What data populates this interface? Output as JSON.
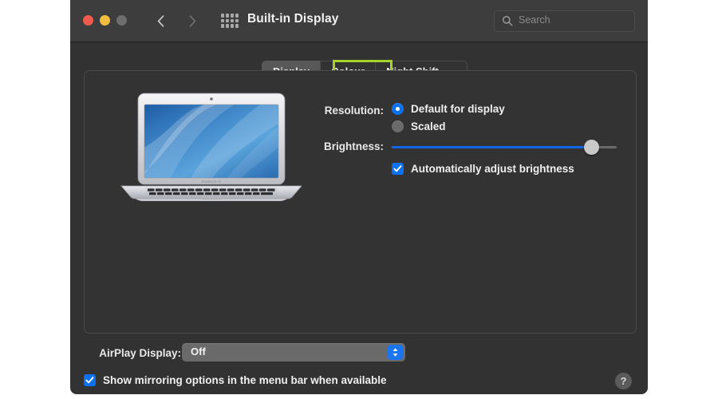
{
  "window": {
    "title": "Built-in Display",
    "traffic_lights": [
      {
        "name": "close",
        "color": "#f05a4f"
      },
      {
        "name": "minimize",
        "color": "#f1bd3f"
      },
      {
        "name": "zoom",
        "color": "#6e6e6e"
      }
    ],
    "nav": {
      "back_icon": "chevron-left-icon",
      "forward_icon": "chevron-right-icon",
      "grid_icon": "grid-view-icon"
    },
    "search": {
      "icon": "search-icon",
      "placeholder": "Search",
      "value": ""
    }
  },
  "tabs": [
    {
      "label": "Display",
      "selected": true,
      "highlighted": true
    },
    {
      "label": "Colour",
      "selected": false,
      "highlighted": false
    },
    {
      "label": "Night Shift",
      "selected": false,
      "highlighted": false
    }
  ],
  "highlight_color": "#a5d32b",
  "preview": {
    "device_icon": "macbook-air-icon",
    "device_label": "MacBook Air"
  },
  "settings": {
    "resolution_label": "Resolution:",
    "resolution_options": [
      {
        "label": "Default for display",
        "selected": true
      },
      {
        "label": "Scaled",
        "selected": false
      }
    ],
    "brightness_label": "Brightness:",
    "brightness_value": 89,
    "auto_brightness": {
      "label": "Automatically adjust brightness",
      "checked": true
    }
  },
  "bottom": {
    "airplay_label": "AirPlay Display:",
    "airplay_value": "Off",
    "airplay_chevron_icon": "chevron-up-down-icon",
    "mirroring": {
      "label": "Show mirroring options in the menu bar when available",
      "checked": true
    },
    "help_label": "?"
  },
  "colors": {
    "window_body": "#323232",
    "titlebar": "#3d3d3d",
    "accent_blue": "#0a72f0",
    "slider_fill": "#1166e8",
    "highlight_green": "#a5d32b"
  }
}
